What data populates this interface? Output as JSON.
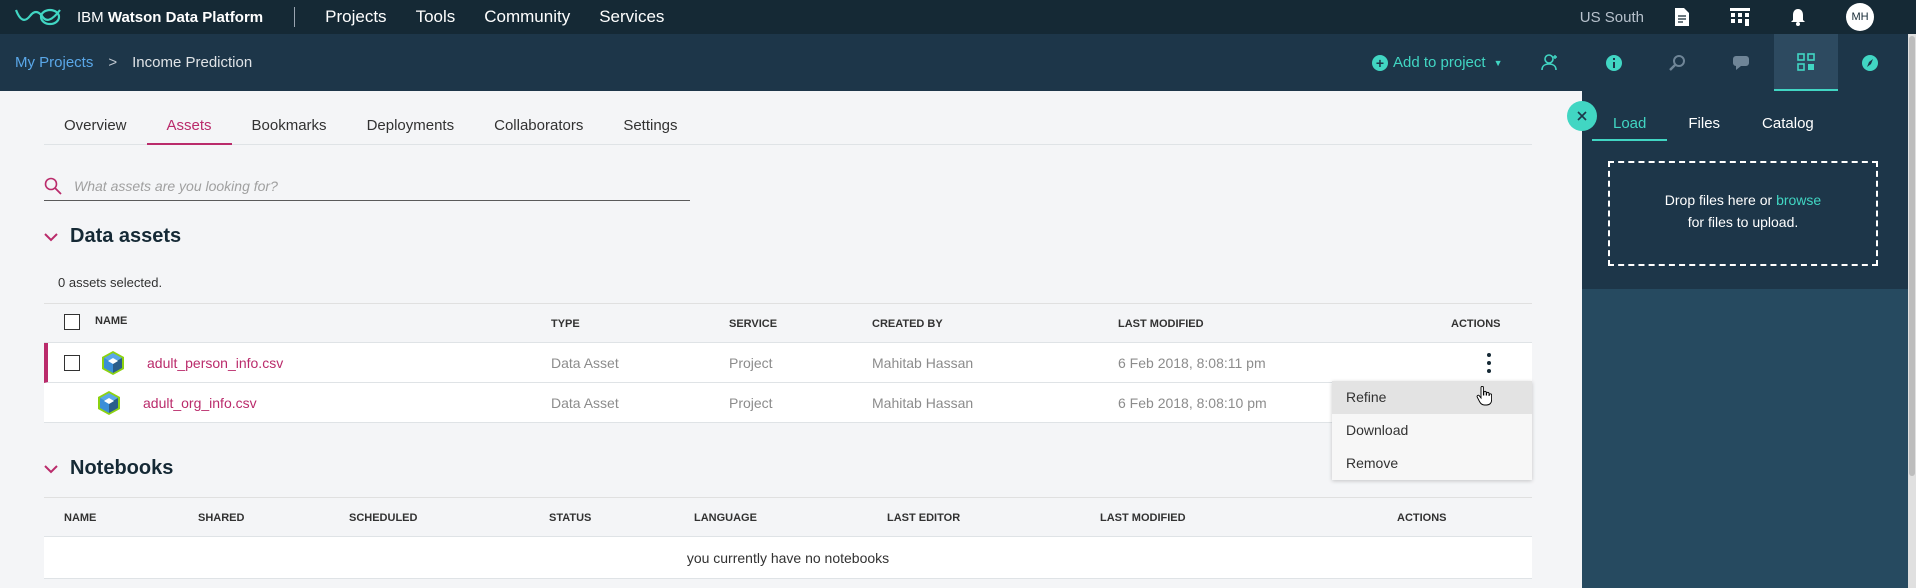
{
  "topbar": {
    "brand_prefix": "IBM",
    "brand_name": "Watson Data Platform",
    "nav": [
      "Projects",
      "Tools",
      "Community",
      "Services"
    ],
    "region": "US South",
    "avatar_initials": "MH"
  },
  "breadcrumb": {
    "root": "My Projects",
    "separator": ">",
    "current": "Income Prediction"
  },
  "add_to_project": "Add to project",
  "tabs": [
    "Overview",
    "Assets",
    "Bookmarks",
    "Deployments",
    "Collaborators",
    "Settings"
  ],
  "active_tab": "Assets",
  "search": {
    "placeholder": "What assets are you looking for?"
  },
  "data_assets": {
    "title": "Data assets",
    "selected_text": "0 assets selected.",
    "columns": [
      "NAME",
      "TYPE",
      "SERVICE",
      "CREATED BY",
      "LAST MODIFIED",
      "ACTIONS"
    ],
    "rows": [
      {
        "name": "adult_person_info.csv",
        "type": "Data Asset",
        "service": "Project",
        "created_by": "Mahitab Hassan",
        "last_modified": "6 Feb 2018, 8:08:11 pm"
      },
      {
        "name": "adult_org_info.csv",
        "type": "Data Asset",
        "service": "Project",
        "created_by": "Mahitab Hassan",
        "last_modified": "6 Feb 2018, 8:08:10 pm"
      }
    ]
  },
  "actions_menu": [
    "Refine",
    "Download",
    "Remove"
  ],
  "notebooks": {
    "title": "Notebooks",
    "columns": [
      "NAME",
      "SHARED",
      "SCHEDULED",
      "STATUS",
      "LANGUAGE",
      "LAST EDITOR",
      "LAST MODIFIED",
      "ACTIONS"
    ],
    "empty_text": "you currently have no notebooks"
  },
  "side_panel": {
    "tabs": [
      "Load",
      "Files",
      "Catalog"
    ],
    "active_tab": "Load",
    "drop_text_1": "Drop files here or ",
    "browse": "browse",
    "drop_text_2": "for files to upload."
  },
  "colors": {
    "accent": "#ba2b6b",
    "teal": "#41d6c3",
    "topbar": "#152935",
    "subbar": "#1d3649"
  }
}
